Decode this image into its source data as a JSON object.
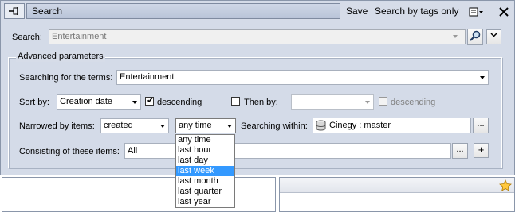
{
  "titlebar": {
    "title": "Search",
    "save_label": "Save",
    "search_tags_label": "Search by tags only",
    "icons": [
      "pin-icon",
      "options-icon",
      "close-icon"
    ]
  },
  "search": {
    "label": "Search:",
    "value": "Entertainment"
  },
  "advanced": {
    "title": "Advanced parameters",
    "terms_label": "Searching for the terms:",
    "terms_value": "Entertainment",
    "sort_label": "Sort by:",
    "sort_value": "Creation date",
    "descending_label": "descending",
    "descending_checked": true,
    "then_by_label": "Then by:",
    "then_by_value": "",
    "then_descending_label": "descending",
    "narrowed_label": "Narrowed by items:",
    "narrowed_value": "created",
    "time_value": "any time",
    "within_label": "Searching within:",
    "within_value": "Cinegy : master",
    "consisting_label": "Consisting of these items:",
    "consisting_value": "All",
    "ellipsis": "...",
    "plus": "+"
  },
  "time_dropdown": {
    "options": [
      "any time",
      "last hour",
      "last day",
      "last week",
      "last month",
      "last quarter",
      "last year"
    ],
    "selected": "last week"
  },
  "colors": {
    "panel_bg": "#d6dce8",
    "selection": "#3399ff"
  }
}
